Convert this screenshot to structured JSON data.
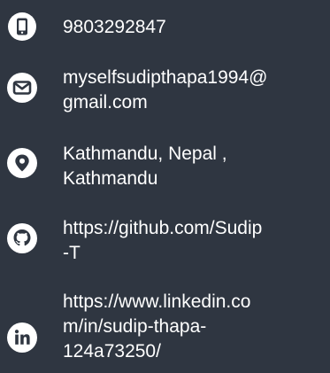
{
  "contact": {
    "phone": {
      "icon": "phone-icon",
      "value": "9803292847"
    },
    "email": {
      "icon": "envelope-icon",
      "line1": "myselfsudipthapa1994@",
      "line2": "gmail.com"
    },
    "location": {
      "icon": "map-pin-icon",
      "line1": "Kathmandu, Nepal ,",
      "line2": "Kathmandu"
    },
    "github": {
      "icon": "github-icon",
      "line1": "https://github.com/Sudip",
      "line2": "-T"
    },
    "linkedin": {
      "icon": "linkedin-icon",
      "line1": "https://www.linkedin.co",
      "line2": "m/in/sudip-thapa-",
      "line3": "124a73250/"
    }
  },
  "colors": {
    "background": "#2f3641",
    "icon_fill": "#ffffff",
    "text": "#ffffff"
  }
}
